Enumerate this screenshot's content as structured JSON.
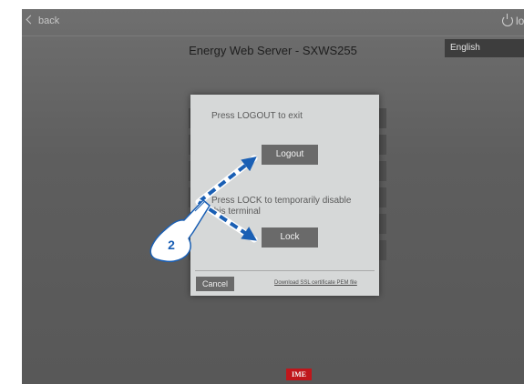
{
  "topbar": {
    "back_label": "back",
    "logout_label": "logout"
  },
  "page_title": "Energy Web Server - SXWS255",
  "language": {
    "selected": "English"
  },
  "dialog": {
    "logout_text": "Press LOGOUT to exit",
    "logout_button": "Logout",
    "lock_text_line1": "Press LOCK to temporarily disable",
    "lock_text_line2": "this terminal",
    "lock_button": "Lock",
    "cancel_button": "Cancel",
    "ssl_link": "Download SSL certificate PEM file"
  },
  "annotation": {
    "step_number": "2",
    "arrow_color": "#1a5fb4"
  },
  "brand_logo": "IME",
  "colors": {
    "brand": "#c0161b",
    "dialog_bg": "#d6d8d8",
    "button_bg": "#6a6a6a"
  },
  "icons": {
    "back": "chevron-left-icon",
    "logout": "power-icon",
    "pointer": "hand-pointer-icon"
  }
}
